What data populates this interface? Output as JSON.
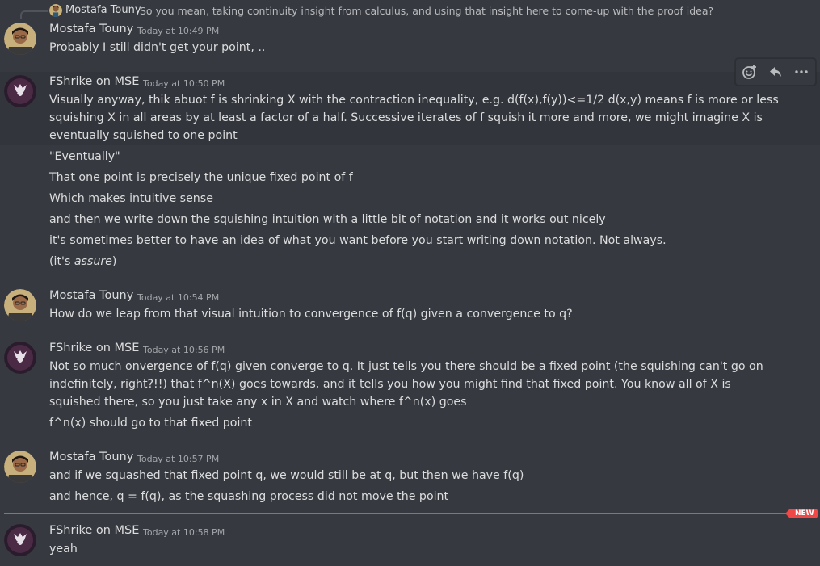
{
  "colors": {
    "background": "#36393f",
    "hover_background": "#32353b",
    "text": "#dcddde",
    "muted": "#a3a6aa",
    "mostafa_name": "#dcddde",
    "fshrike_name": "#dcddde",
    "new_divider": "#f04747"
  },
  "reply": {
    "author": "Mostafa Touny",
    "text": "So you mean, taking continuity insight from calculus, and using that insight here to come-up with the proof idea?"
  },
  "messages": [
    {
      "author": "Mostafa Touny",
      "timestamp": "Today at 10:49 PM",
      "lines": [
        "Probably I still didn't get your point, .."
      ]
    },
    {
      "author": "FShrike on MSE",
      "timestamp": "Today at 10:50 PM",
      "lines": [
        "Visually anyway, thik abuot f is shrinking X with the contraction inequality, e.g. d(f(x),f(y))<=1/2 d(x,y) means f is more or less squishing X in all areas by at least a factor of a half. Successive iterates of f squish it more and more, we might imagine X is eventually squished to one point",
        "\"Eventually\"",
        "That one point is precisely the unique fixed point of f",
        "Which makes intuitive sense",
        "and then we write down the squishing intuition with a little bit of notation and it works out nicely",
        "it's sometimes better to have an idea of what you want before you start writing down notation. Not always."
      ],
      "last_line": {
        "prefix": "(it's ",
        "italic": "assure",
        "suffix": ")"
      }
    },
    {
      "author": "Mostafa Touny",
      "timestamp": "Today at 10:54 PM",
      "lines": [
        "How do we leap from that visual intuition to convergence of f(q) given a convergence to q?"
      ]
    },
    {
      "author": "FShrike on MSE",
      "timestamp": "Today at 10:56 PM",
      "lines": [
        "Not so much onvergence of f(q) given converge to q. It just tells you there should be a fixed point (the squishing can't go on indefinitely, right?!!) that f^n(X) goes towards, and it tells you how you might find that fixed point. You know all of X is squished there, so you just take any x in X and watch where f^n(x) goes",
        "f^n(x) should go to that fixed point"
      ]
    },
    {
      "author": "Mostafa Touny",
      "timestamp": "Today at 10:57 PM",
      "lines": [
        "and if we squashed that fixed point q, we would still be at q, but then we have f(q)",
        "and hence, q = f(q), as the squashing process did not move the point"
      ]
    },
    {
      "author": "FShrike on MSE",
      "timestamp": "Today at 10:58 PM",
      "lines": [
        "yeah"
      ]
    }
  ],
  "new_badge": "NEW",
  "toolbar": {
    "icons": [
      "add-reaction-icon",
      "reply-icon",
      "more-options-icon"
    ]
  }
}
